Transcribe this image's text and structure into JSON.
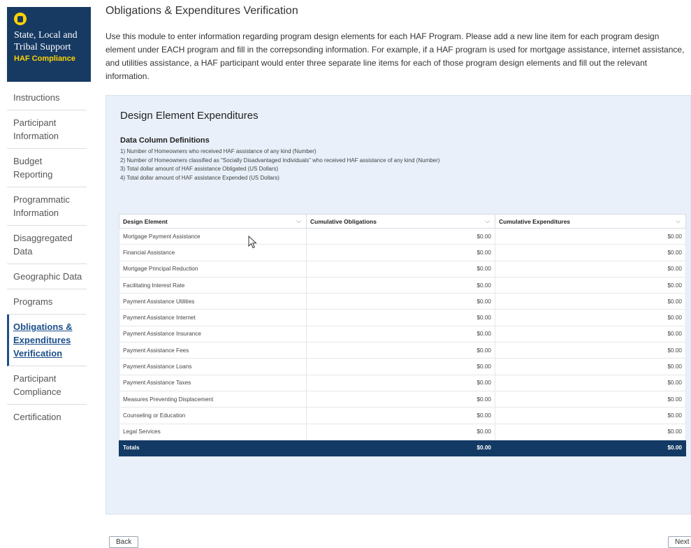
{
  "brand": {
    "line1": "State, Local and",
    "line2": "Tribal Support",
    "subtitle": "HAF Compliance",
    "seal_icon": "seal-icon"
  },
  "nav": {
    "items": [
      {
        "line1": "Instructions",
        "line2": ""
      },
      {
        "line1": "Participant",
        "line2": "Information"
      },
      {
        "line1": "Budget",
        "line2": "Reporting"
      },
      {
        "line1": "Programmatic",
        "line2": "Information"
      },
      {
        "line1": "Disaggregated",
        "line2": "Data"
      },
      {
        "line1": "Geographic Data",
        "line2": ""
      },
      {
        "line1": "Programs",
        "line2": ""
      },
      {
        "line1": "Obligations &",
        "line2": "Expenditures",
        "line3": "Verification"
      },
      {
        "line1": "Participant",
        "line2": "Compliance"
      },
      {
        "line1": "Certification",
        "line2": ""
      }
    ],
    "active_index": 7
  },
  "main": {
    "title": "Obligations & Expenditures Verification",
    "intro": "Use this module to enter information regarding program design elements for each HAF Program. Please add a new line item for each program design element under EACH program and fill in the correpsonding information. For example, if a HAF program is used for mortgage assistance, internet assistance, and utilities assistance, a HAF participant would enter three separate line items for each of those program design elements and fill out the relevant information."
  },
  "panel": {
    "title": "Design Element Expenditures",
    "defs_title": "Data Column Definitions",
    "defs": [
      "1) Number of Homeowners who received HAF assistance of any kind (Number)",
      "2) Number of Homeowners classified as \"Socially Disadvantaged Individuals\" who received HAF assistance of any kind (Number)",
      "3) Total dollar amount of HAF assistance Obligated (US Dollars)",
      "4) Total dollar amount of HAF assistance Expended (US Dollars)"
    ]
  },
  "table": {
    "headers": [
      "Design Element",
      "Cumulative Obligations",
      "Cumulative Expenditures"
    ],
    "chevron": "⌵",
    "rows": [
      [
        "Mortgage Payment Assistance",
        "$0.00",
        "$0.00"
      ],
      [
        "Financial Assistance",
        "$0.00",
        "$0.00"
      ],
      [
        "Mortgage Principal Reduction",
        "$0.00",
        "$0.00"
      ],
      [
        "Facilitating Interest Rate",
        "$0.00",
        "$0.00"
      ],
      [
        "Payment Assistance Utilities",
        "$0.00",
        "$0.00"
      ],
      [
        "Payment Assistance Internet",
        "$0.00",
        "$0.00"
      ],
      [
        "Payment Assistance Insurance",
        "$0.00",
        "$0.00"
      ],
      [
        "Payment Assistance Fees",
        "$0.00",
        "$0.00"
      ],
      [
        "Payment Assistance Loans",
        "$0.00",
        "$0.00"
      ],
      [
        "Payment Assistance Taxes",
        "$0.00",
        "$0.00"
      ],
      [
        "Measures Preventing Displacement",
        "$0.00",
        "$0.00"
      ],
      [
        "Counseling or Education",
        "$0.00",
        "$0.00"
      ],
      [
        "Legal Services",
        "$0.00",
        "$0.00"
      ]
    ],
    "totals": [
      "Totals",
      "$0.00",
      "$0.00"
    ]
  },
  "footer": {
    "back_label": "Back",
    "next_label": "Next"
  },
  "colors": {
    "brand_bg": "#173a63",
    "brand_accent": "#ffd200",
    "panel_bg": "#e9f0fa",
    "totals_bg": "#123a64",
    "active_link": "#1b4f8a"
  }
}
